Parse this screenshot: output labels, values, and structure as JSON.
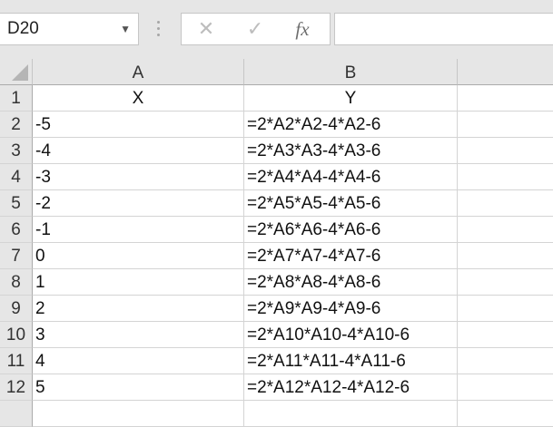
{
  "name_box": {
    "value": "D20"
  },
  "formula_bar": {
    "cancel_glyph": "✕",
    "enter_glyph": "✓",
    "fx_label": "fx",
    "value": ""
  },
  "columns": [
    "A",
    "B"
  ],
  "rows": [
    {
      "num": "1",
      "a": "X",
      "b": "Y"
    },
    {
      "num": "2",
      "a": "-5",
      "b": "=2*A2*A2-4*A2-6"
    },
    {
      "num": "3",
      "a": "-4",
      "b": "=2*A3*A3-4*A3-6"
    },
    {
      "num": "4",
      "a": "-3",
      "b": "=2*A4*A4-4*A4-6"
    },
    {
      "num": "5",
      "a": "-2",
      "b": "=2*A5*A5-4*A5-6"
    },
    {
      "num": "6",
      "a": "-1",
      "b": "=2*A6*A6-4*A6-6"
    },
    {
      "num": "7",
      "a": "0",
      "b": "=2*A7*A7-4*A7-6"
    },
    {
      "num": "8",
      "a": "1",
      "b": "=2*A8*A8-4*A8-6"
    },
    {
      "num": "9",
      "a": "2",
      "b": "=2*A9*A9-4*A9-6"
    },
    {
      "num": "10",
      "a": "3",
      "b": "=2*A10*A10-4*A10-6"
    },
    {
      "num": "11",
      "a": "4",
      "b": "=2*A11*A11-4*A11-6"
    },
    {
      "num": "12",
      "a": "5",
      "b": "=2*A12*A12-4*A12-6"
    },
    {
      "num": "",
      "a": "",
      "b": ""
    }
  ]
}
